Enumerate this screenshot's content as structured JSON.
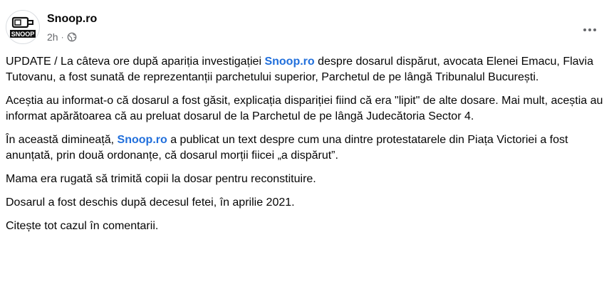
{
  "post": {
    "author": "Snoop.ro",
    "timestamp": "2h",
    "separator": "·",
    "privacy_icon": "globe-icon",
    "more_icon": "more-options-icon",
    "avatar_logo_text": "SNOOP",
    "paragraphs": [
      {
        "before": "UPDATE / La câteva ore după apariția investigației ",
        "link": "Snoop.ro",
        "after": " despre dosarul dispărut, avocata Elenei Emacu, Flavia Tutovanu, a fost sunată de reprezentanții parchetului superior, Parchetul de pe lângă Tribunalul București."
      },
      {
        "text": "Aceștia au informat-o că dosarul a fost găsit, explicația dispariției fiind că era \"lipit\" de alte dosare. Mai mult, aceștia au informat apărătoarea că au preluat dosarul de la Parchetul de pe lângă Judecătoria Sector 4."
      },
      {
        "before": "În această dimineață, ",
        "link": "Snoop.ro",
        "after": " a publicat un text despre cum una dintre protestatarele din Piața Victoriei a fost anunțată, prin două ordonanțe, că dosarul morții fiicei „a dispărut”."
      },
      {
        "text": "Mama era rugată să trimită copii la dosar pentru reconstituire."
      },
      {
        "text": "Dosarul a fost deschis după decesul fetei, în aprilie 2021."
      },
      {
        "text": "Citește tot cazul în comentarii."
      }
    ]
  },
  "colors": {
    "link": "#216fdb",
    "meta": "#65676b",
    "text": "#050505"
  }
}
